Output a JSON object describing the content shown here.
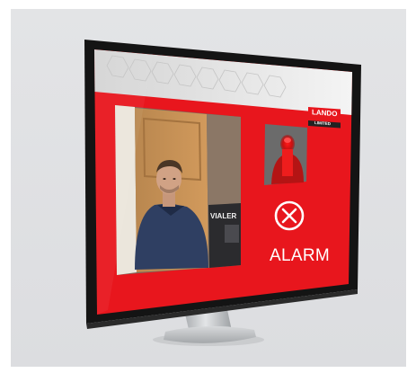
{
  "product": {
    "status_label": "ALARM",
    "status_icon": "close-circle-icon",
    "brand_logo": "lando-limited",
    "brand_logo_text": [
      "LANDO",
      "LIMITED"
    ],
    "background_sign_text": "VIALER"
  },
  "colors": {
    "alarm_red": "#e8161d",
    "bezel": "#111111",
    "backdrop": "#dedfe1",
    "stand": "#c8cacc"
  }
}
